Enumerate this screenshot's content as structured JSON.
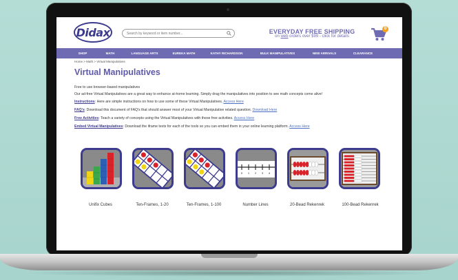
{
  "header": {
    "logo_text": "Didax",
    "search_placeholder": "Search by keyword or item number...",
    "shipping_line1": "EVERYDAY FREE SHIPPING",
    "shipping_line2_prefix": "on ",
    "shipping_line2_link": "web",
    "shipping_line2_suffix": " orders over $99 - click for details",
    "cart_count": "0"
  },
  "nav": {
    "items": [
      "SHOP",
      "MATH",
      "LANGUAGE ARTS",
      "EUREKA MATH",
      "KATHY RICHARDSON",
      "BULK MANIPULATIVES",
      "NEW ARRIVALS",
      "CLEARANCE"
    ]
  },
  "breadcrumb": "Home > Math > Virtual Manipulatives",
  "page_title": "Virtual Manipulatives",
  "content": {
    "intro1": "Free to use browser-based manipulatives",
    "intro2": "Our ad-free Virtual Manipulatives are a great way to enhance at-home learning. Simply drag the manipulatives into position to see math concepts come alive!",
    "rows": [
      {
        "key": "Instructions",
        "text": ": Here are simple instructions on how to use some of these Virtual Manipulatives. ",
        "link": "Access Here"
      },
      {
        "key": "FAQ's",
        "text": ": Download this document of FAQ's that should answer most of your Virtual Manipulative related question. ",
        "link": "Download Here"
      },
      {
        "key": "Free Activities",
        "text": ": Teach a variety of concepts using the Virtual Manipulatives with these free activities. ",
        "link": "Access Here"
      },
      {
        "key": "Embed Virtual Manipulatives",
        "text": ": Download the iframe texts for each of the tools so you can embed them in your online learning platform. ",
        "link": "Access Here"
      }
    ]
  },
  "tiles": [
    {
      "label": "Unifix Cubes",
      "icon": "unifix-cubes-icon"
    },
    {
      "label": "Ten-Frames, 1-20",
      "icon": "ten-frame-icon"
    },
    {
      "label": "Ten-Frames, 1-100",
      "icon": "ten-frame-icon"
    },
    {
      "label": "Number Lines",
      "icon": "number-line-icon"
    },
    {
      "label": "20-Bead Rekenrek",
      "icon": "rekenrek-icon"
    },
    {
      "label": "100-Bead Rekenrek",
      "icon": "rekenrek-icon"
    }
  ],
  "number_line_ticks": [
    "0",
    "1",
    "2",
    "3",
    "4"
  ],
  "colors": {
    "brand": "#6f6bb2",
    "dark_brand": "#3d3b8e",
    "badge": "#f7a21b",
    "background": "#a9d6cf"
  }
}
